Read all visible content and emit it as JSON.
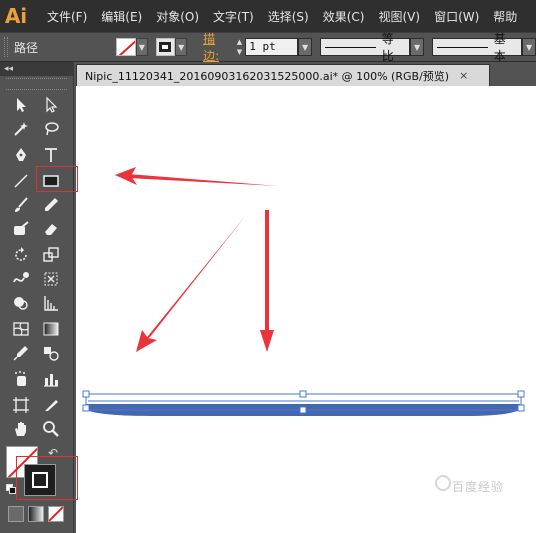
{
  "app": {
    "logo": "Ai"
  },
  "menu": {
    "items": [
      "文件(F)",
      "编辑(E)",
      "对象(O)",
      "文字(T)",
      "选择(S)",
      "效果(C)",
      "视图(V)",
      "窗口(W)",
      "帮助"
    ]
  },
  "control_bar": {
    "selection_type": "路径",
    "stroke_label": "描边:",
    "stroke_weight": "1 pt",
    "variable_width_profile": "等比",
    "brush_definition": "基本"
  },
  "tools_panel": {
    "collapse_glyph": "◂◂"
  },
  "document": {
    "tab_title": "Nipic_11120341_20160903162031525000.ai* @ 100% (RGB/预览)",
    "close_glyph": "×"
  },
  "watermark": {
    "text": "百度经验"
  },
  "colors": {
    "menubar_bg": "#2f2f2f",
    "panel_bg": "#535353",
    "logo": "#e9a23b",
    "arrow_red": "#e8343a",
    "selection_blue": "#4a78d6",
    "shape_fill": "#4468b0"
  },
  "icons": [
    "selection-tool-icon",
    "direct-selection-tool-icon",
    "magic-wand-tool-icon",
    "lasso-tool-icon",
    "pen-tool-icon",
    "type-tool-icon",
    "line-segment-tool-icon",
    "rectangle-tool-icon",
    "paintbrush-tool-icon",
    "pencil-tool-icon",
    "blob-brush-tool-icon",
    "eraser-tool-icon",
    "rotate-tool-icon",
    "scale-tool-icon",
    "warp-tool-icon",
    "free-transform-tool-icon",
    "shape-builder-tool-icon",
    "perspective-grid-tool-icon",
    "mesh-tool-icon",
    "gradient-tool-icon",
    "eyedropper-tool-icon",
    "blend-tool-icon",
    "symbol-sprayer-tool-icon",
    "column-graph-tool-icon",
    "artboard-tool-icon",
    "slice-tool-icon",
    "hand-tool-icon",
    "zoom-tool-icon"
  ]
}
